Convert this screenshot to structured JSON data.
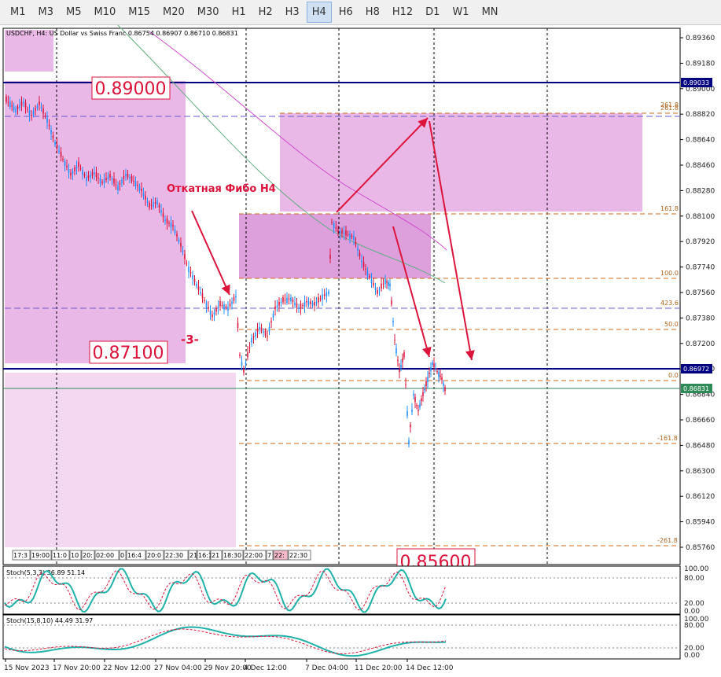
{
  "toolbar": {
    "timeframes": [
      "M1",
      "M3",
      "M5",
      "M10",
      "M15",
      "M20",
      "M30",
      "H1",
      "H2",
      "H3",
      "H4",
      "H6",
      "H8",
      "H12",
      "D1",
      "W1",
      "MN"
    ],
    "active": "H4"
  },
  "chart": {
    "header": "USDCHF, H4:  US Dollar vs Swiss Franc  0.86754 0.86907 0.86710 0.86831",
    "price_axis": [
      "0.89360",
      "0.89180",
      "0.89000",
      "0.88820",
      "0.88640",
      "0.88460",
      "0.88280",
      "0.88100",
      "0.87920",
      "0.87740",
      "0.87560",
      "0.87380",
      "0.87200",
      "0.87020",
      "0.86840",
      "0.86660",
      "0.86480",
      "0.86300",
      "0.86120",
      "0.85940",
      "0.85760"
    ],
    "hline_top_label": "0.89033",
    "hline_mid_label": "0.86972",
    "current_price_label": "0.86831",
    "big_labels": {
      "top": "0.89000",
      "mid": "0.87100",
      "bottom": "0.85600"
    },
    "annotation": "Откатная Фибо H4",
    "wave_label": "-3-",
    "fibo_levels": [
      "261.8",
      "261.8",
      "161.8",
      "100.0",
      "423.6",
      "50.0",
      "0.0",
      "-161.8",
      "-261.8"
    ],
    "session_labels": [
      "17:3",
      "19:00",
      "11:0",
      "10",
      "20:",
      "02:00",
      "0",
      "16:4",
      "20:0",
      "22:30",
      "21",
      "16:1",
      "21",
      "18:30",
      "22:00",
      "7",
      "22:",
      "22:30"
    ],
    "colors": {
      "zone": "#e9b8e6",
      "zone_dark": "#dda0dd",
      "zone_light": "#f4d7f1",
      "hline": "#000080",
      "arrow": "#dc143c",
      "candle_up": "#1e90ff",
      "candle_down": "#dc143c",
      "ma_green": "#5fae7f",
      "ma_magenta": "#d04ad0"
    }
  },
  "stoch1": {
    "label": "Stoch(5,3,3) 36.89 51.14",
    "levels": [
      "100.00",
      "80.00",
      "20.00",
      "0.00"
    ]
  },
  "stoch2": {
    "label": "Stoch(15,8,10) 44.49 31.97",
    "levels": [
      "100.00",
      "80.00",
      "20.00",
      "0.00"
    ]
  },
  "time_axis": [
    "15 Nov 2023",
    "17 Nov 20:00",
    "22 Nov 12:00",
    "27 Nov 04:00",
    "29 Nov 20:00",
    "4 Dec 12:00",
    "7 Dec 04:00",
    "11 Dec 20:00",
    "14 Dec 12:00"
  ]
}
